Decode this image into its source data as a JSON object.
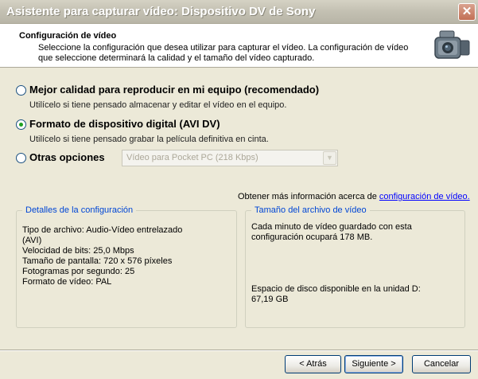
{
  "window": {
    "title": "Asistente para capturar vídeo: Dispositivo DV de Sony",
    "close_glyph": "✕"
  },
  "header": {
    "title": "Configuración de vídeo",
    "description": "Seleccione la configuración que desea utilizar para capturar el vídeo. La configuración de vídeo que seleccione determinará la calidad y el tamaño del vídeo capturado.",
    "icon": "camcorder-icon"
  },
  "options": [
    {
      "label": "Mejor calidad para reproducir en mi equipo (recomendado)",
      "description": "Utilícelo si tiene pensado almacenar y editar el vídeo en el equipo.",
      "checked": false
    },
    {
      "label": "Formato de dispositivo digital (AVI DV)",
      "description": "Utilícelo si tiene pensado grabar la película definitiva en cinta.",
      "checked": true
    },
    {
      "label": "Otras opciones",
      "checked": false,
      "select_value": "Vídeo para Pocket PC (218 Kbps)",
      "select_disabled": true
    }
  ],
  "more_info": {
    "prefix": "Obtener más información acerca de ",
    "link": "configuración de vídeo."
  },
  "details": {
    "legend": "Detalles de la configuración",
    "lines": [
      "Tipo de archivo: Audio-Vídeo entrelazado",
      "(AVI)",
      "Velocidad de bits: 25,0 Mbps",
      "Tamaño de pantalla: 720 x 576 píxeles",
      "Fotogramas por segundo: 25",
      "Formato de vídeo: PAL"
    ]
  },
  "file_size": {
    "legend": "Tamaño del archivo de vídeo",
    "text": "Cada minuto de vídeo guardado con esta configuración ocupará 178 MB.",
    "disk_space": "Espacio de disco disponible en la unidad D: 67,19 GB"
  },
  "buttons": {
    "back": "< Atrás",
    "next": "Siguiente >",
    "cancel": "Cancelar"
  },
  "colors": {
    "accent": "#0046d5",
    "link": "#0000ff",
    "radio_checked": "#21a121"
  }
}
